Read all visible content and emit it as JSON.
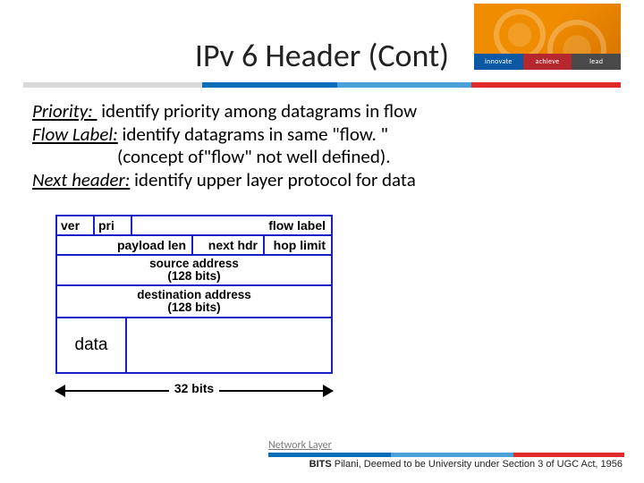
{
  "logo": {
    "words": [
      "innovate",
      "achieve",
      "lead"
    ]
  },
  "title": "IPv 6 Header (Cont)",
  "body": {
    "l1a": "Priority: ",
    "l1b": " identify priority among datagrams in flow",
    "l2a": "Flow Label:",
    "l2b": " identify datagrams in same \"flow. \"",
    "l3": "                    (concept of\"flow\" not well defined).",
    "l4a": "Next header:",
    "l4b": " identify upper layer protocol for data"
  },
  "diagram": {
    "row1": {
      "ver": "ver",
      "pri": "pri",
      "flow": "flow label"
    },
    "row2": {
      "plen": "payload len",
      "nhdr": "next hdr",
      "hop": "hop limit"
    },
    "src_line1": "source address",
    "src_line2": "(128 bits)",
    "dst_line1": "destination address",
    "dst_line2": "(128 bits)",
    "data": "data",
    "width": "32 bits"
  },
  "footer": {
    "link": "Network Layer",
    "org_bold": "BITS ",
    "org_rest": "Pilani, Deemed to be University under Section 3 of UGC Act, 1956"
  }
}
